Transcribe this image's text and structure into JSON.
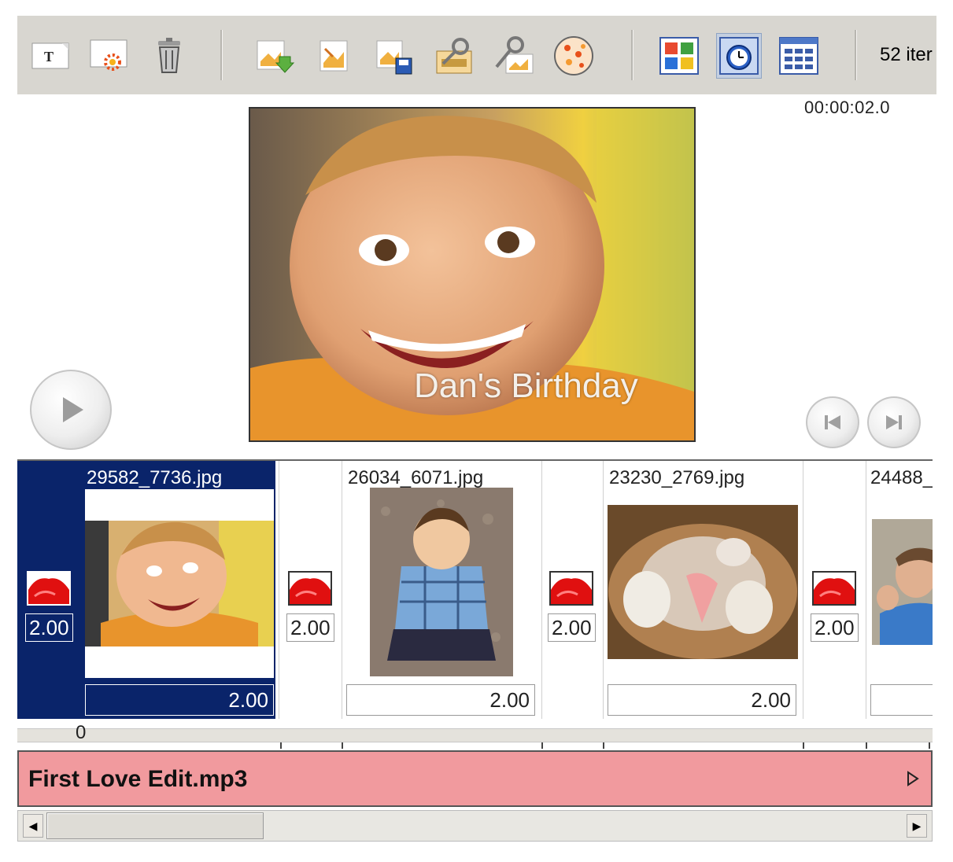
{
  "toolbar": {
    "items_count": "52 iter"
  },
  "preview": {
    "timecode": "00:00:02.0",
    "caption": "Dan's Birthday"
  },
  "storyboard": {
    "slides": [
      {
        "filename": "29582_7736.jpg",
        "duration": "2.00",
        "transition_time": "2.00",
        "selected": true
      },
      {
        "filename": "26034_6071.jpg",
        "duration": "2.00",
        "transition_time": "2.00",
        "selected": false
      },
      {
        "filename": "23230_2769.jpg",
        "duration": "2.00",
        "transition_time": "2.00",
        "selected": false
      },
      {
        "filename": "24488_",
        "duration": "",
        "transition_time": "2.00",
        "selected": false
      }
    ],
    "ruler_start": "0"
  },
  "audio": {
    "track_name": "First Love Edit.mp3"
  },
  "colors": {
    "toolbar_bg": "#d8d6d0",
    "selection": "#0a246a",
    "audio_track": "#f19a9e"
  },
  "icons": [
    "add-text-icon",
    "add-effect-icon",
    "delete-icon",
    "import-photos-icon",
    "edit-photo-icon",
    "save-photo-icon",
    "photo-settings-icon",
    "tools-icon",
    "shuffle-icon",
    "thumbnail-view-icon",
    "timeline-view-icon",
    "details-view-icon"
  ]
}
